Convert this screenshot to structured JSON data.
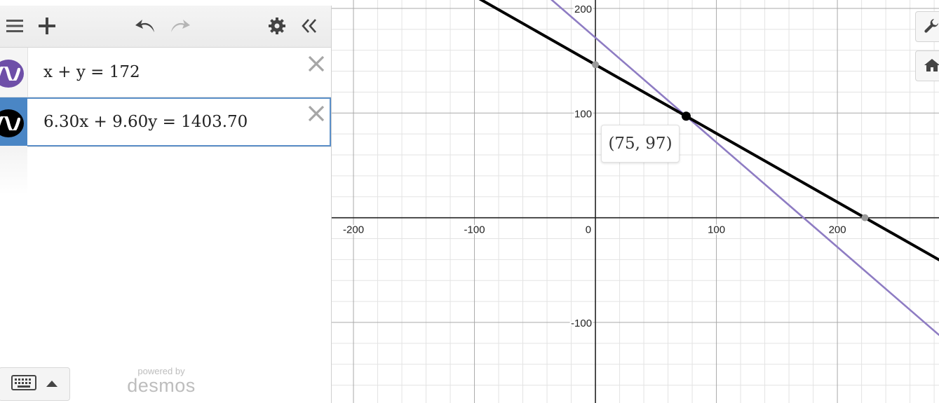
{
  "toolbar": {
    "menu_icon": "hamburger-icon",
    "add_icon": "plus-icon",
    "undo_icon": "undo-icon",
    "redo_icon": "redo-icon",
    "settings_icon": "gear-icon",
    "collapse_icon": "double-chevron-left-icon"
  },
  "expressions": [
    {
      "latex_text": "x + y = 172",
      "color": "#6e4fa8",
      "active": false
    },
    {
      "latex_text": "6.30x + 9.60y = 1403.70",
      "color": "#000000",
      "active": true
    }
  ],
  "footer": {
    "keyboard_icon": "keyboard-icon",
    "powered_by": "powered by",
    "brand": "desmos"
  },
  "graph": {
    "x_ticks": [
      "-200",
      "-100",
      "0",
      "100",
      "200"
    ],
    "y_ticks": [
      "200",
      "100",
      "-100"
    ],
    "point_label": "(75, 97)",
    "buttons": [
      "wrench-icon",
      "home-icon"
    ]
  },
  "chart_data": {
    "type": "line",
    "xlim": [
      -218,
      284
    ],
    "ylim": [
      -177,
      208
    ],
    "grid": true,
    "major_step": 100,
    "minor_step": 20,
    "series": [
      {
        "equation": "x + y = 172",
        "color": "#8e7cc3",
        "points": [
          [
            -218,
            390
          ],
          [
            284,
            -112
          ]
        ]
      },
      {
        "equation": "6.30x + 9.60y = 1403.70",
        "color": "#000000",
        "points": [
          [
            -218,
            289.3
          ],
          [
            284,
            -40.2
          ]
        ]
      }
    ],
    "points": [
      {
        "x": 75,
        "y": 97,
        "color": "#000000",
        "labeled": true
      },
      {
        "x": 0,
        "y": 146.2,
        "color": "#9a9a9a",
        "labeled": false
      },
      {
        "x": 222.8,
        "y": 0,
        "color": "#9a9a9a",
        "labeled": false
      }
    ],
    "colors": {
      "axis": "#222222",
      "major_grid": "#a9a9a9",
      "minor_grid": "#e3e3e3"
    }
  }
}
